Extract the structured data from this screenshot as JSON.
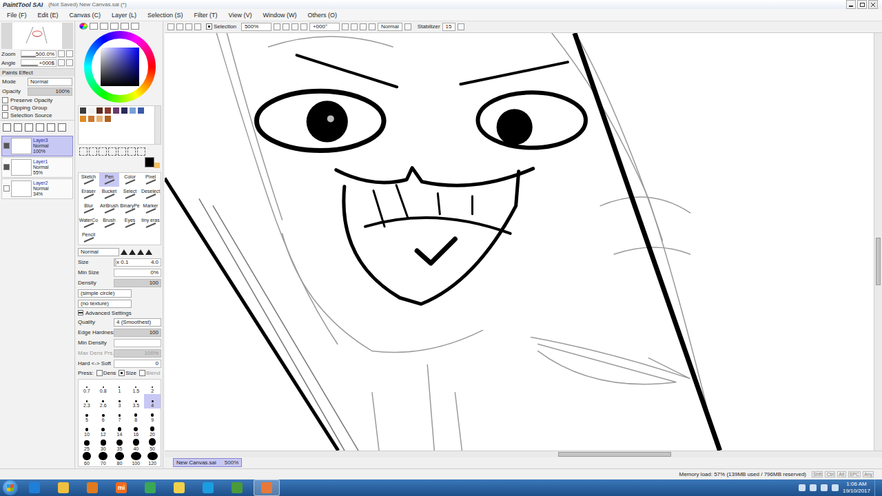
{
  "window": {
    "app": "PaintTool SAI",
    "title": "(Not Saved) New Canvas.sai (*)"
  },
  "menu": [
    "File (F)",
    "Edit (E)",
    "Canvas (C)",
    "Layer (L)",
    "Selection (S)",
    "Filter (T)",
    "View (V)",
    "Window (W)",
    "Others (O)"
  ],
  "toolbar": {
    "selection_label": "Selection",
    "selection_checked": true,
    "zoom": "500%",
    "angle": "+000°",
    "mode": "Normal",
    "stabilizer_label": "Stabilizer",
    "stabilizer": "15"
  },
  "navigator": {
    "zoom_label": "Zoom",
    "zoom": "500.0%",
    "zoom_level": 0.5,
    "angle_label": "Angle",
    "angle": "+000$",
    "angle_level": 0.5
  },
  "paint_effect": {
    "title": "Paints Effect",
    "mode_label": "Mode",
    "mode": "Normal",
    "opacity_label": "Opacity",
    "opacity": "100%",
    "opacity_level": 1,
    "options": [
      {
        "label": "Preserve Opacity",
        "checked": false
      },
      {
        "label": "Clipping Group",
        "checked": false
      },
      {
        "label": "Selection Source",
        "checked": false
      }
    ]
  },
  "layers": [
    {
      "name": "Layer3",
      "mode": "Normal",
      "opacity": "100%",
      "visible": true,
      "selected": true
    },
    {
      "name": "Layer1",
      "mode": "Normal",
      "opacity": "55%",
      "visible": true,
      "selected": false
    },
    {
      "name": "Layer2",
      "mode": "Normal",
      "opacity": "34%",
      "visible": false,
      "selected": false
    }
  ],
  "swatches": [
    {
      "color": "#3c3c3c"
    },
    {
      "color": "#f2f2f2"
    },
    {
      "color": "#5a2a1a"
    },
    {
      "color": "#8a3a2a"
    },
    {
      "color": "#6a3a6a"
    },
    {
      "color": "#2a2a5a"
    },
    {
      "color": "#7aa0d8"
    },
    {
      "color": "#3a5aa8"
    },
    {
      "color": "#e08a20"
    },
    {
      "color": "#c87830"
    },
    {
      "color": "#e8b070"
    },
    {
      "color": "#b06020"
    }
  ],
  "tools": [
    {
      "label": "Sketch",
      "selected": false
    },
    {
      "label": "Pen",
      "selected": true
    },
    {
      "label": "Color",
      "selected": false
    },
    {
      "label": "Pixel",
      "selected": false
    },
    {
      "label": "Eraser",
      "selected": false
    },
    {
      "label": "Bucket",
      "selected": false
    },
    {
      "label": "Select",
      "selected": false
    },
    {
      "label": "Deselect",
      "selected": false
    },
    {
      "label": "Blur",
      "selected": false
    },
    {
      "label": "AirBrush",
      "selected": false
    },
    {
      "label": "BinaryPe",
      "selected": false
    },
    {
      "label": "Marker",
      "selected": false
    },
    {
      "label": "WaterCo",
      "selected": false
    },
    {
      "label": "Brush",
      "selected": false
    },
    {
      "label": "Eyes",
      "selected": false
    },
    {
      "label": "tiny eras",
      "selected": false
    },
    {
      "label": "Pencil",
      "selected": false
    }
  ],
  "brush": {
    "blend_mode": "Normal",
    "sliders": [
      {
        "label": "Size",
        "prefix": "x 0.1",
        "value": "4.0",
        "level": 0.04
      },
      {
        "label": "Min Size",
        "prefix": "",
        "value": "0%",
        "level": 0
      },
      {
        "label": "Density",
        "prefix": "",
        "value": "100",
        "level": 1
      }
    ],
    "shape": "(simple circle)",
    "texture": "(no texture)",
    "advanced": "Advanced Settings",
    "quality_label": "Quality",
    "quality": "4 (Smoothest)",
    "adv_sliders": [
      {
        "label": "Edge Hardness",
        "value": "100",
        "level": 1,
        "disabled": false
      },
      {
        "label": "Min Density",
        "value": "",
        "level": 0,
        "disabled": false
      },
      {
        "label": "Max Dens Prs.",
        "value": "100%",
        "level": 1,
        "disabled": true
      },
      {
        "label": "Hard <-> Soft",
        "value": "0",
        "level": 0,
        "disabled": false
      }
    ],
    "press_label": "Press:",
    "press": [
      {
        "label": "Dens",
        "checked": false,
        "disabled": false
      },
      {
        "label": "Size",
        "checked": true,
        "disabled": false
      },
      {
        "label": "Blend",
        "checked": false,
        "disabled": true
      }
    ]
  },
  "sizes": [
    {
      "label": "0.7",
      "selected": false
    },
    {
      "label": "0.8",
      "selected": false
    },
    {
      "label": "1",
      "selected": false
    },
    {
      "label": "1.5",
      "selected": false
    },
    {
      "label": "2",
      "selected": false
    },
    {
      "label": "2.3",
      "selected": false
    },
    {
      "label": "2.6",
      "selected": false
    },
    {
      "label": "3",
      "selected": false
    },
    {
      "label": "3.5",
      "selected": false
    },
    {
      "label": "4",
      "selected": true
    },
    {
      "label": "5",
      "selected": false
    },
    {
      "label": "6",
      "selected": false
    },
    {
      "label": "7",
      "selected": false
    },
    {
      "label": "8",
      "selected": false
    },
    {
      "label": "9",
      "selected": false
    },
    {
      "label": "10",
      "selected": false
    },
    {
      "label": "12",
      "selected": false
    },
    {
      "label": "14",
      "selected": false
    },
    {
      "label": "16",
      "selected": false
    },
    {
      "label": "20",
      "selected": false
    },
    {
      "label": "25",
      "selected": false
    },
    {
      "label": "30",
      "selected": false
    },
    {
      "label": "35",
      "selected": false
    },
    {
      "label": "40",
      "selected": false
    },
    {
      "label": "50",
      "selected": false
    },
    {
      "label": "60",
      "selected": false
    },
    {
      "label": "70",
      "selected": false
    },
    {
      "label": "80",
      "selected": false
    },
    {
      "label": "100",
      "selected": false
    },
    {
      "label": "120",
      "selected": false
    }
  ],
  "canvas_tab": {
    "name": "New Canvas.sai",
    "zoom": "500%"
  },
  "scroll": {
    "h_start": 0.55,
    "h_size": 0.16,
    "v_start": 0.53,
    "v_size": 0.12
  },
  "status": "Memory load: 57% (139MB used / 796MB reserved)",
  "keys": [
    "Shft",
    "Ctrl",
    "Alt",
    "SPC",
    "Any"
  ],
  "taskbar": {
    "apps": [
      {
        "label": "",
        "color": "#1e7fd8",
        "active": false
      },
      {
        "label": "",
        "color": "#f0c040",
        "active": false
      },
      {
        "label": "",
        "color": "#e07a20",
        "active": false
      },
      {
        "label": "mi",
        "color": "#f26b1d",
        "active": false
      },
      {
        "label": "",
        "color": "#3aa757",
        "active": false
      },
      {
        "label": "",
        "color": "#f2d04a",
        "active": false
      },
      {
        "label": "",
        "color": "#1a9de0",
        "active": false
      },
      {
        "label": "",
        "color": "#4a9a3a",
        "active": false
      },
      {
        "label": "",
        "color": "#e8783a",
        "active": true
      }
    ],
    "time": "1:06 AM",
    "date": "19/10/2017"
  }
}
